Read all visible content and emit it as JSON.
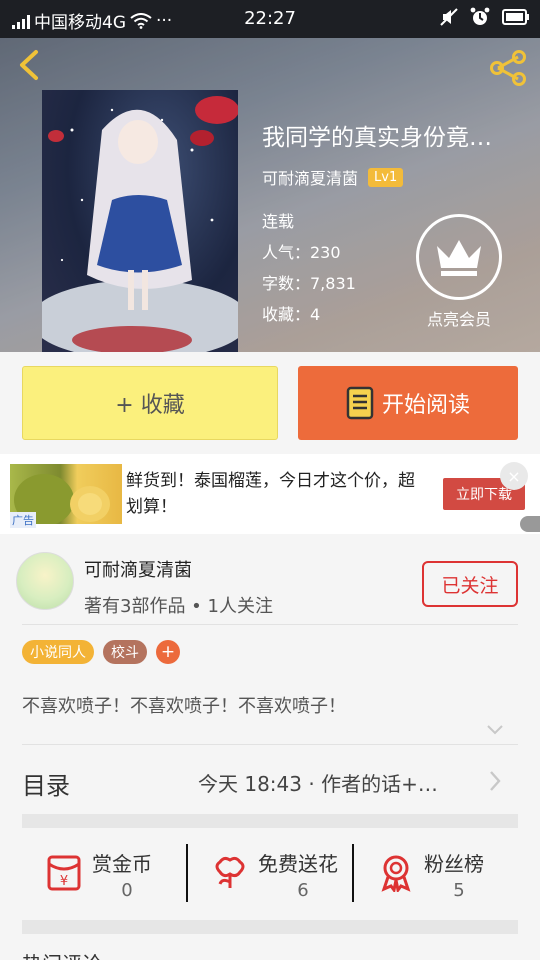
{
  "status_bar": {
    "carrier": "中国移动4G",
    "more": "···",
    "time": "22:27"
  },
  "book": {
    "title": "我同学的真实身份竟…",
    "author": "可耐滴夏清菌",
    "level": "Lv1",
    "status": "连载",
    "popularity": "人气：230",
    "word_count": "字数：7,831",
    "favorites": "收藏：4",
    "vip_label": "点亮会员"
  },
  "actions": {
    "favorite_label": "+ 收藏",
    "read_label": "开始阅读"
  },
  "ad": {
    "tag": "广告",
    "text": "鲜货到！泰国榴莲，今日才这个价，超划算！",
    "download_label": "立即下载",
    "close": "×"
  },
  "author_card": {
    "name": "可耐滴夏清菌",
    "stats": "著有3部作品 • 1人关注",
    "follow_label": "已关注",
    "tags": [
      "小说同人",
      "校斗"
    ],
    "add_tag": "+",
    "description": "不喜欢喷子！不喜欢喷子！不喜欢喷子！"
  },
  "toc": {
    "label": "目录",
    "info": "今天 18:43 · 作者的话+…"
  },
  "reward": [
    {
      "label": "赏金币",
      "value": "0",
      "icon": "red-envelope-icon"
    },
    {
      "label": "免费送花",
      "value": "6",
      "icon": "flower-icon"
    },
    {
      "label": "粉丝榜",
      "value": "5",
      "icon": "medal-icon"
    }
  ],
  "bottom_peek": "热门评论",
  "colors": {
    "accent_orange": "#ed6b3b",
    "favorite_yellow": "#fbf07d",
    "level_badge": "#f3bb3a",
    "follow_red": "#dd3333",
    "status_bar": "#1d1f24"
  }
}
